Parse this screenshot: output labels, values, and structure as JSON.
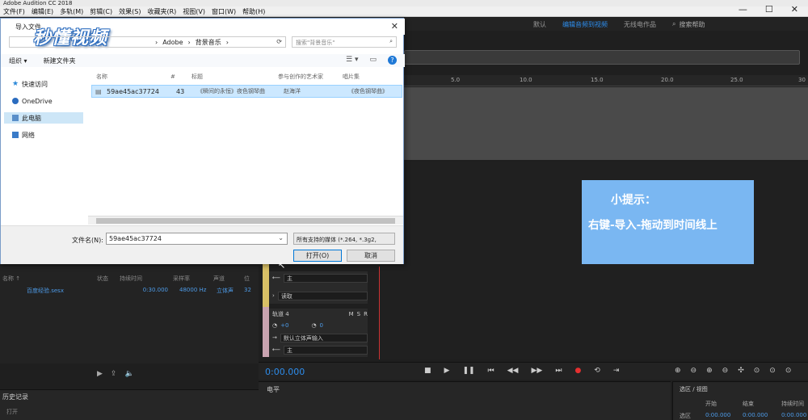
{
  "app_title": "Adobe Audition CC 2018",
  "menu": [
    "文件(F)",
    "编辑(E)",
    "多轨(M)",
    "剪辑(C)",
    "效果(S)",
    "收藏夹(R)",
    "视图(V)",
    "窗口(W)",
    "帮助(H)"
  ],
  "workspaces": [
    "默认",
    "编辑音频到视频",
    "无线电作品"
  ],
  "search_help": "搜索帮助",
  "ruler_ticks": [
    "5.0",
    "10.0",
    "15.0",
    "20.0",
    "25.0",
    "30"
  ],
  "tip": {
    "title": "小提示：",
    "body": "右键-导入-拖动到时间线上"
  },
  "files_panel": {
    "columns": [
      "名称 ↑",
      "状态",
      "持续时间",
      "采样率",
      "声道",
      "位"
    ],
    "row": {
      "name": "百度经验.sesx",
      "duration": "0:30.000",
      "rate": "48000 Hz",
      "channels": "立体声",
      "bits": "32"
    }
  },
  "history": {
    "title": "历史记录",
    "item": "打开"
  },
  "tracks": {
    "track3": {
      "out": "主",
      "read": "读取"
    },
    "track4": {
      "name": "轨道 4",
      "m": "M",
      "s": "S",
      "r": "R",
      "vol": "+0",
      "pan": "0",
      "input": "默认立体声输入",
      "out": "主"
    }
  },
  "timecode": "0:00.000",
  "levels_title": "电平",
  "selview": {
    "title": "选区 / 视图",
    "start": "开始",
    "end": "结束",
    "duration": "持续时间",
    "row_label": "选区",
    "start_val": "0:00.000",
    "end_val": "0:00.000",
    "dur_val": "0:00.000"
  },
  "dialog": {
    "title": "导入文件",
    "logo": "秒懂视频",
    "path": [
      "Adobe",
      "背景音乐"
    ],
    "search_placeholder": "搜索\"背景音乐\"",
    "organize": "组织 ▾",
    "new_folder": "新建文件夹",
    "nav": [
      "快速访问",
      "OneDrive",
      "此电脑",
      "网络"
    ],
    "columns": [
      "名称",
      "#",
      "标题",
      "参与创作的艺术家",
      "唱片集"
    ],
    "file": {
      "name": "59ae45ac37724",
      "num": "43",
      "title": "《瞬间的永恒》夜色钢琴曲",
      "artist": "赵海洋",
      "album": "《夜色钢琴曲》"
    },
    "filename_label": "文件名(N):",
    "filename_value": "59ae45ac37724",
    "filetype": "所有支持的媒体 (*.264, *.3g2,",
    "open": "打开(O)",
    "cancel": "取消"
  }
}
